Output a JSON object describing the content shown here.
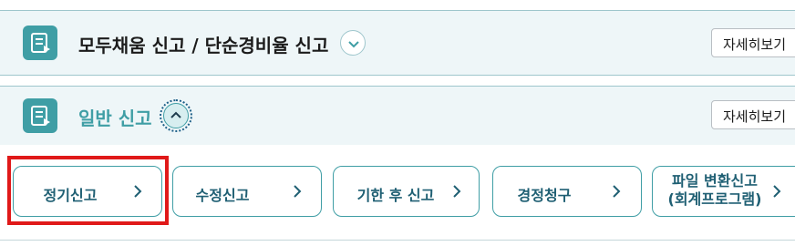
{
  "sections": [
    {
      "title": "모두채움 신고 / 단순경비율 신고",
      "expanded": false,
      "detail_label": "자세히보기"
    },
    {
      "title": "일반 신고",
      "expanded": true,
      "detail_label": "자세히보기"
    }
  ],
  "options": [
    {
      "label": "정기신고"
    },
    {
      "label": "수정신고"
    },
    {
      "label": "기한 후 신고"
    },
    {
      "label": "경정청구"
    },
    {
      "label": "파일 변환신고\n(회계프로그램)"
    }
  ],
  "highlight_color": "#e01919",
  "accent_color": "#3f9ea5"
}
